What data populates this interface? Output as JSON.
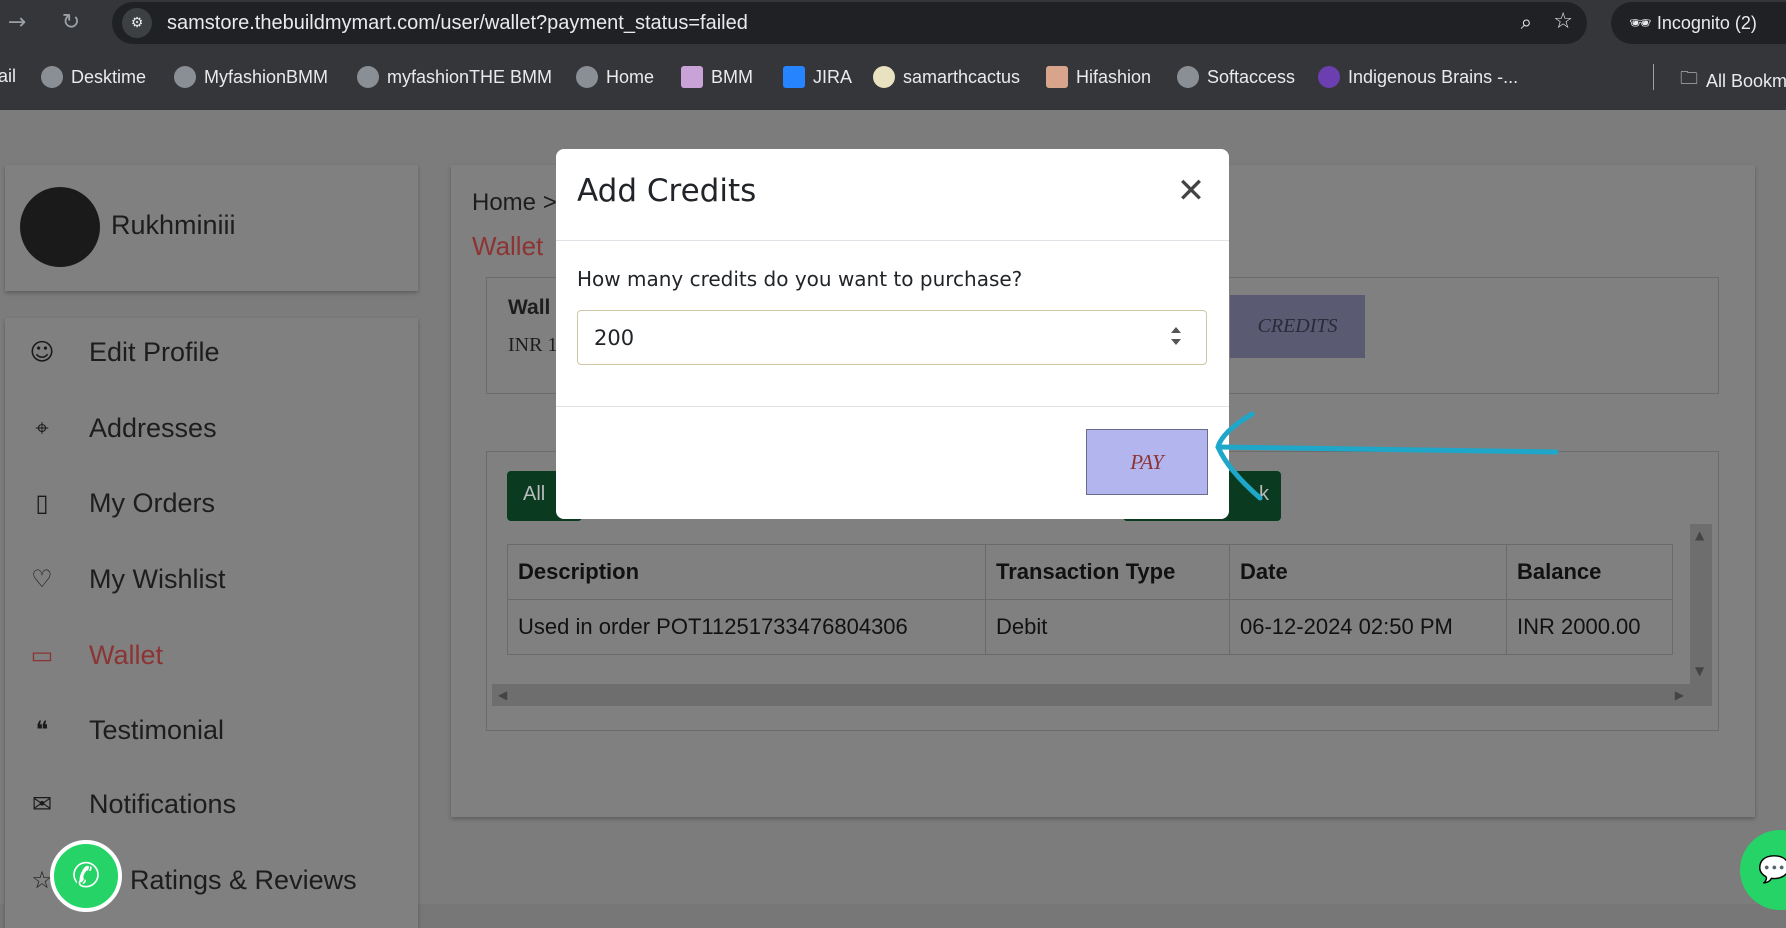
{
  "browser": {
    "url": "samstore.thebuildmymart.com/user/wallet?payment_status=failed",
    "incognito_label": "Incognito (2)",
    "bookmarks": [
      {
        "label": "ail"
      },
      {
        "label": "Desktime"
      },
      {
        "label": "MyfashionBMM"
      },
      {
        "label": "myfashionTHE BMM"
      },
      {
        "label": "Home"
      },
      {
        "label": "BMM"
      },
      {
        "label": "JIRA"
      },
      {
        "label": "samarthcactus"
      },
      {
        "label": "Hifashion"
      },
      {
        "label": "Softaccess"
      },
      {
        "label": "Indigenous Brains -..."
      },
      {
        "label": "All Bookm"
      }
    ]
  },
  "profile": {
    "name": "Rukhminiii"
  },
  "sidebar": {
    "items": [
      {
        "label": "Edit Profile",
        "icon": "profile-icon"
      },
      {
        "label": "Addresses",
        "icon": "location-pin-icon"
      },
      {
        "label": "My Orders",
        "icon": "orders-icon"
      },
      {
        "label": "My Wishlist",
        "icon": "heart-icon"
      },
      {
        "label": "Wallet",
        "icon": "wallet-icon"
      },
      {
        "label": "Testimonial",
        "icon": "quote-icon"
      },
      {
        "label": "Notifications",
        "icon": "bell-icon"
      },
      {
        "label": "Ratings & Reviews",
        "icon": "star-icon"
      }
    ]
  },
  "main": {
    "breadcrumb": "Home >",
    "title": "Wallet",
    "balance_label": "Wall",
    "balance_value": "INR 1",
    "add_credits_label": "CREDITS",
    "filter_all_label": "All",
    "filter_right_label": "k",
    "table": {
      "headers": [
        "Description",
        "Transaction Type",
        "Date",
        "Balance"
      ],
      "rows": [
        [
          "Used in order POT11251733476804306",
          "Debit",
          "06-12-2024 02:50 PM",
          "INR 2000.00"
        ]
      ]
    }
  },
  "modal": {
    "title": "Add Credits",
    "question": "How many credits do you want to purchase?",
    "input_value": "200",
    "pay_label": "PAY"
  },
  "colors": {
    "accent": "#8c3434",
    "pay_button": "#b3b6ee",
    "arrow": "#1ea7c9",
    "whatsapp": "#25d366"
  }
}
